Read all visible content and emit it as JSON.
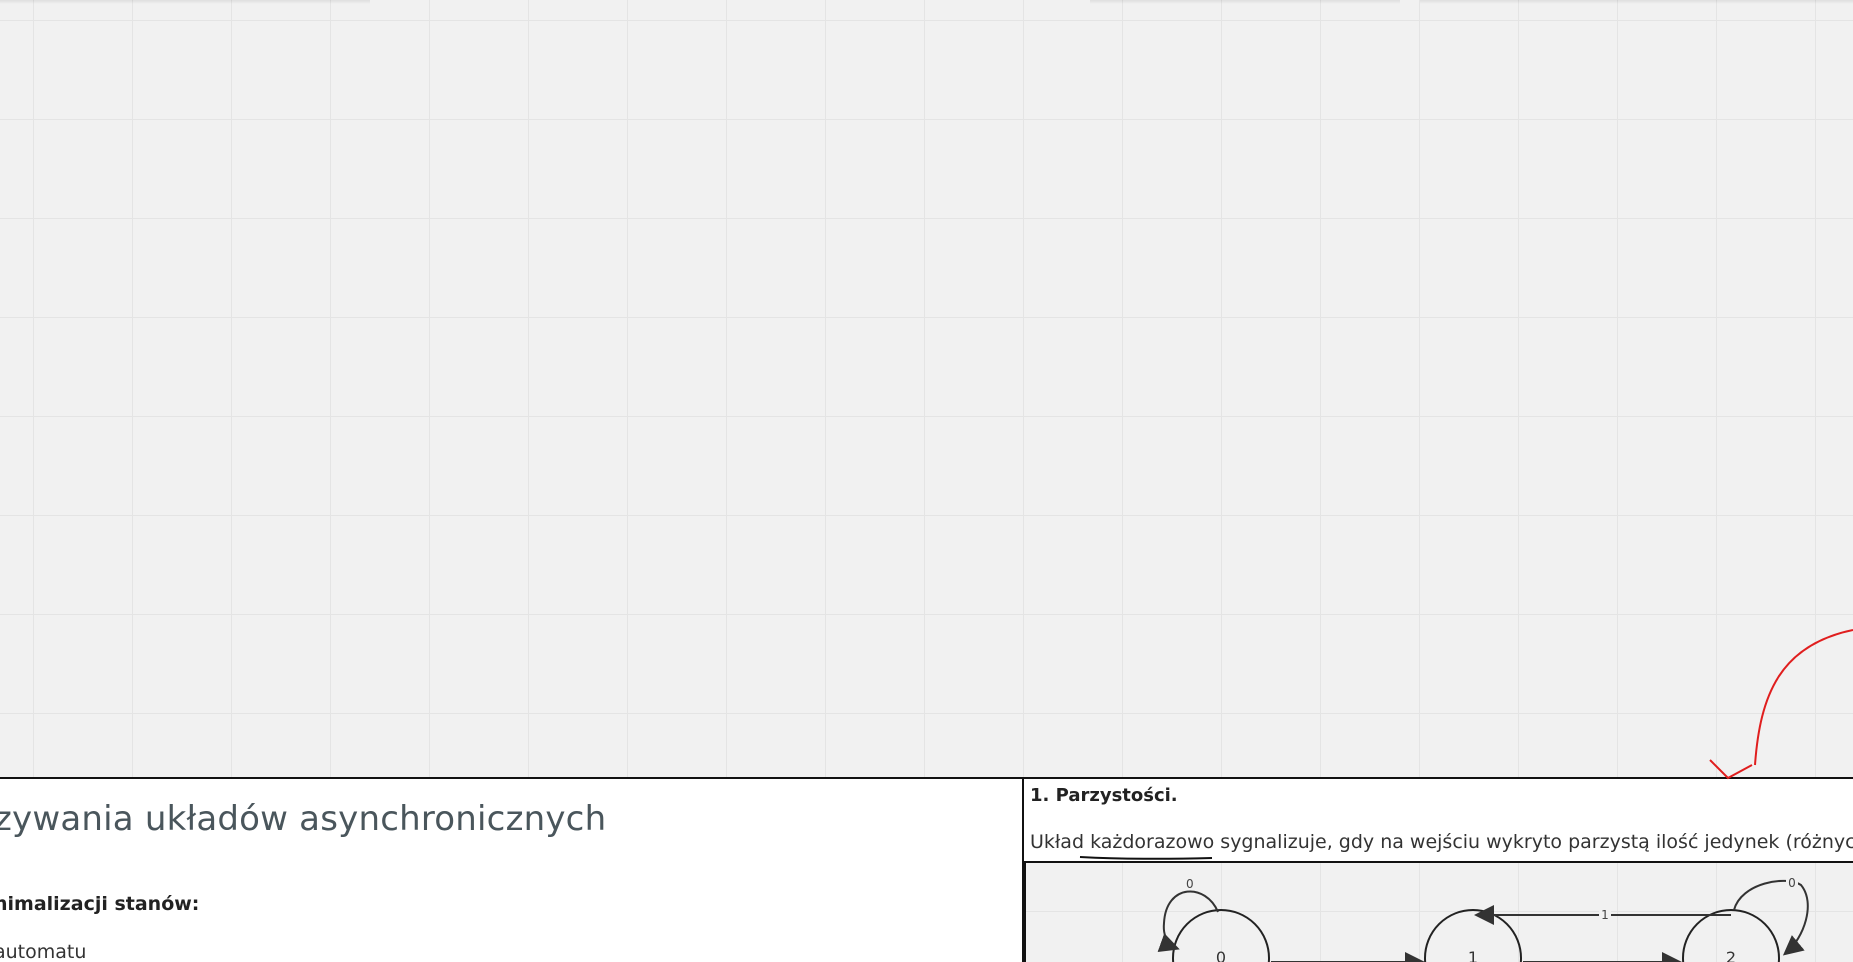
{
  "document": {
    "title": "zywania układów asynchronicznych",
    "subheading": "nimalizacji stanów:",
    "line": "automatu"
  },
  "section": {
    "title": "1. Parzystości.",
    "text_parts": [
      "Układ ",
      "każdorazowo",
      " sygnalizuje, gdy na wejściu wykryto parzystą ilość jedynek (różnych o"
    ]
  },
  "diagram": {
    "states": [
      "0",
      "1",
      "2"
    ],
    "edge_labels": {
      "self_loop_left": "0",
      "top_arrow": "1",
      "self_loop_right": "0"
    }
  },
  "annotation": {
    "color": "#e01e1e"
  }
}
